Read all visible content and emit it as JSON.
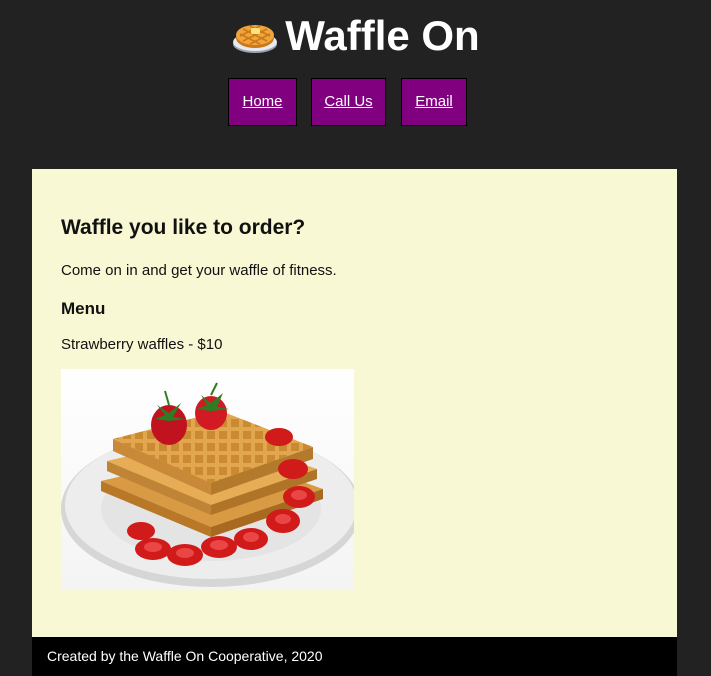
{
  "header": {
    "logo_icon": "waffle-emoji-icon",
    "title": "Waffle On"
  },
  "nav": {
    "items": [
      {
        "label": "Home"
      },
      {
        "label": "Call Us"
      },
      {
        "label": "Email"
      }
    ]
  },
  "main": {
    "heading": "Waffle you like to order?",
    "intro": "Come on in and get your waffle of fitness.",
    "menu_heading": "Menu",
    "menu_items": [
      {
        "text": "Strawberry waffles - $10",
        "image": "strawberry-waffles-photo"
      }
    ]
  },
  "footer": {
    "text": "Created by the Waffle On Cooperative, 2020"
  },
  "colors": {
    "page_background": "#222222",
    "nav_button": "#800080",
    "content_background": "#f8f8d4",
    "footer_background": "#000000"
  }
}
